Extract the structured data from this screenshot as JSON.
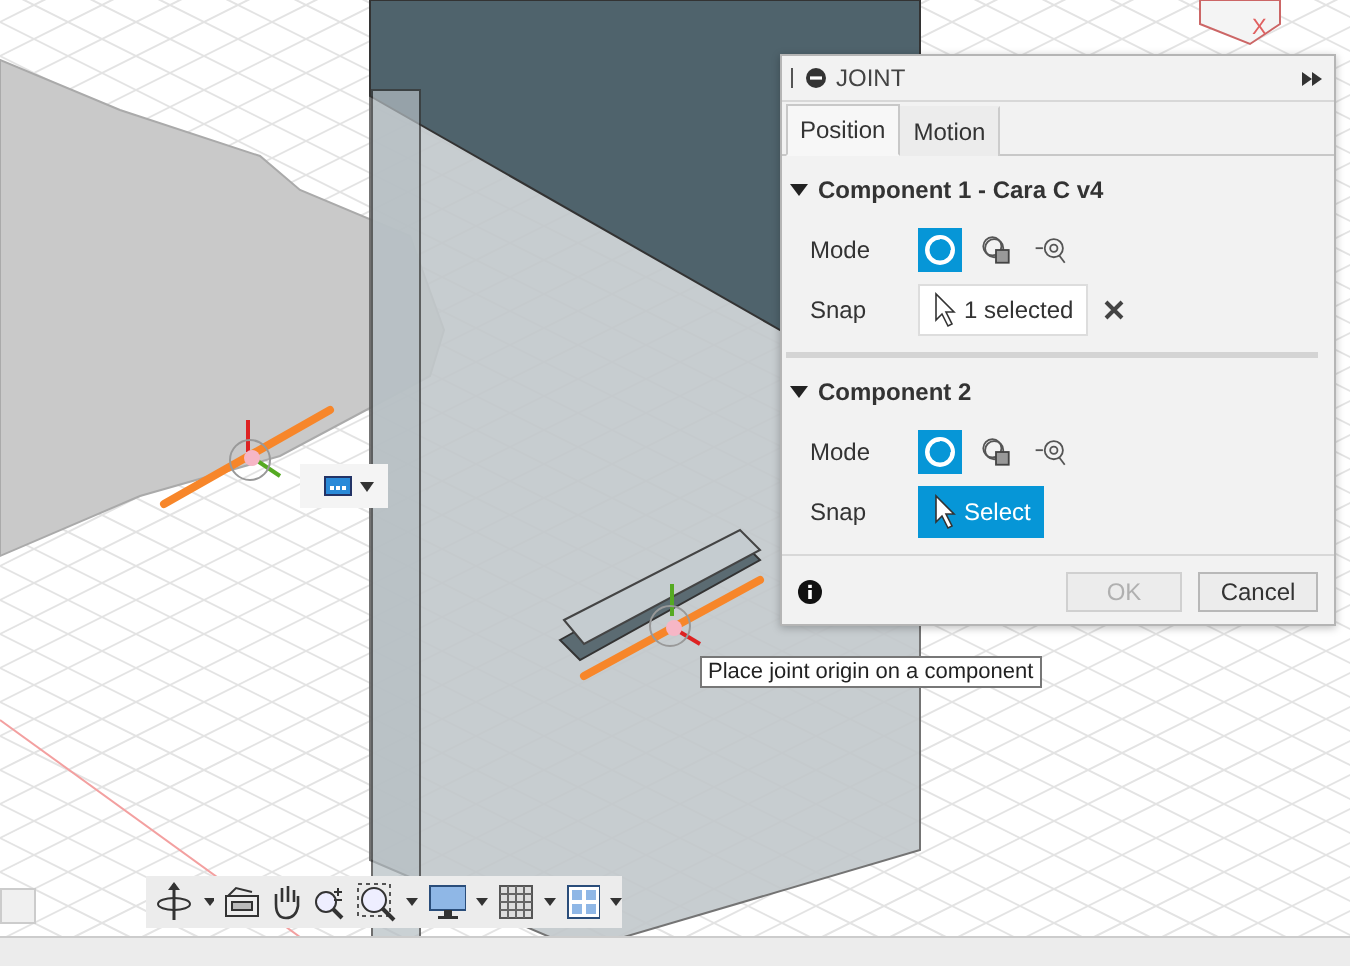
{
  "viewport": {
    "view_cube_axis": "X",
    "tooltip": "Place joint origin on a component"
  },
  "joint_dialog": {
    "title": "JOINT",
    "tabs": [
      {
        "label": "Position",
        "selected": true
      },
      {
        "label": "Motion",
        "selected": false
      }
    ],
    "sections": [
      {
        "title": "Component 1 - Cara C v4",
        "expanded": true,
        "mode_label": "Mode",
        "modes": [
          {
            "selected": true
          },
          {
            "selected": false
          },
          {
            "selected": false
          }
        ],
        "snap": {
          "label": "Snap",
          "kind": "selected",
          "value": "1 selected",
          "clearable": true
        }
      },
      {
        "title": "Component 2",
        "expanded": true,
        "mode_label": "Mode",
        "modes": [
          {
            "selected": true
          },
          {
            "selected": false
          },
          {
            "selected": false
          }
        ],
        "snap": {
          "label": "Snap",
          "kind": "prompt",
          "value": "Select",
          "clearable": false
        }
      }
    ],
    "buttons": [
      {
        "label": "OK",
        "disabled": true
      },
      {
        "label": "Cancel",
        "disabled": false
      }
    ]
  }
}
